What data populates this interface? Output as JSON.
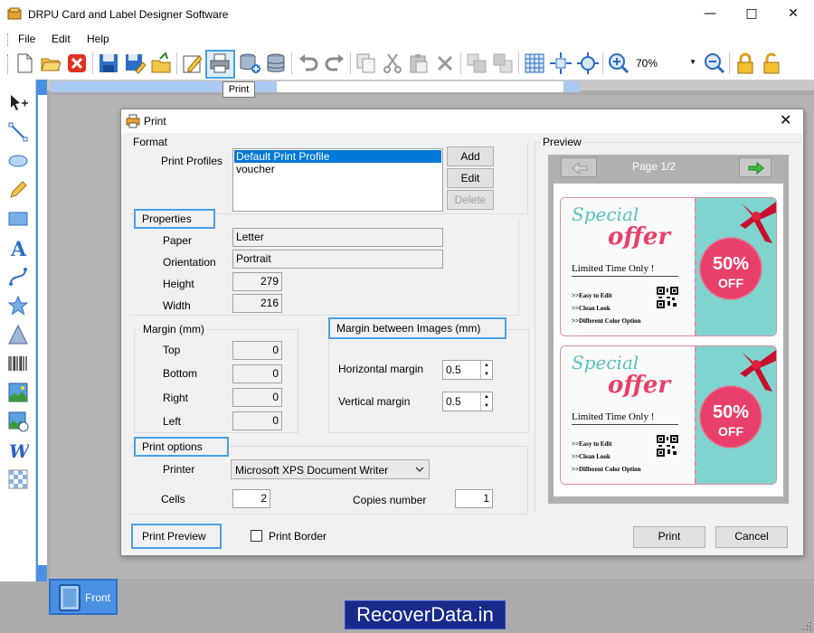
{
  "app": {
    "title": "DRPU Card and Label Designer Software"
  },
  "menu": {
    "file": "File",
    "edit": "Edit",
    "help": "Help"
  },
  "toolbar": {
    "zoom": "70%",
    "tooltip": "Print"
  },
  "dialog": {
    "title": "Print",
    "format_label": "Format",
    "print_profiles_label": "Print Profiles",
    "profiles": [
      "Default Print Profile",
      "voucher"
    ],
    "add": "Add",
    "edit": "Edit",
    "delete": "Delete",
    "properties_label": "Properties",
    "paper_label": "Paper",
    "paper_value": "Letter",
    "orientation_label": "Orientation",
    "orientation_value": "Portrait",
    "height_label": "Height",
    "height_value": "279",
    "width_label": "Width",
    "width_value": "216",
    "margin_label": "Margin (mm)",
    "top_label": "Top",
    "top_value": "0",
    "bottom_label": "Bottom",
    "bottom_value": "0",
    "right_label": "Right",
    "right_value": "0",
    "left_label": "Left",
    "left_value": "0",
    "margin_images_label": "Margin between Images (mm)",
    "horizontal_margin_label": "Horizontal margin",
    "horizontal_margin_value": "0.5",
    "vertical_margin_label": "Vertical margin",
    "vertical_margin_value": "0.5",
    "print_options_label": "Print options",
    "printer_label": "Printer",
    "printer_value": "Microsoft XPS Document Writer",
    "cells_label": "Cells",
    "cells_value": "2",
    "copies_label": "Copies number",
    "copies_value": "1",
    "print_preview": "Print Preview",
    "print_border": "Print Border",
    "print": "Print",
    "cancel": "Cancel",
    "preview_label": "Preview",
    "page_indicator": "Page 1/2"
  },
  "coupon": {
    "special": "Special",
    "offer": "offer",
    "limited": "Limited Time Only !",
    "bullet1": ">>Easy to Edit",
    "bullet2": ">>Clean Look",
    "bullet3": ">>Different Color Option",
    "discount": "50%",
    "off": "OFF"
  },
  "front_tab": "Front",
  "watermark": "RecoverData.in",
  "colors": {
    "accent": "#4aa0e6",
    "coupon_teal": "#7fd4d0",
    "coupon_pink": "#e8406a"
  }
}
